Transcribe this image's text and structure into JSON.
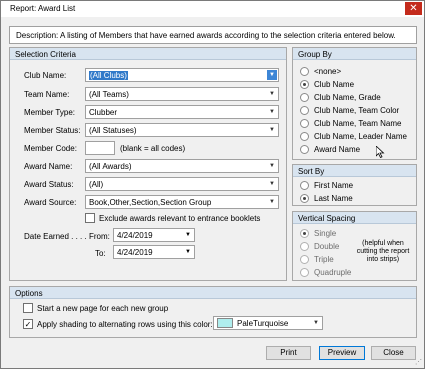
{
  "window": {
    "title": "Report:  Award List",
    "close_symbol": "✕"
  },
  "description": {
    "text": "Description:  A listing of Members that have earned awards according to the selection criteria entered below."
  },
  "selection_criteria": {
    "header": "Selection Criteria",
    "club_name": {
      "label": "Club Name:",
      "value": "(All Clubs)"
    },
    "team_name": {
      "label": "Team Name:",
      "value": "(All Teams)"
    },
    "member_type": {
      "label": "Member Type:",
      "value": "Clubber"
    },
    "member_status": {
      "label": "Member Status:",
      "value": "(All Statuses)"
    },
    "member_code": {
      "label": "Member Code:",
      "value": "",
      "hint": "(blank = all codes)"
    },
    "award_name": {
      "label": "Award Name:",
      "value": "(All Awards)"
    },
    "award_status": {
      "label": "Award Status:",
      "value": "(All)"
    },
    "award_source": {
      "label": "Award Source:",
      "value": "Book,Other,Section,Section Group"
    },
    "exclude_checkbox": {
      "label": "Exclude awards relevant to entrance booklets",
      "checked": false
    },
    "date_earned": {
      "label": "Date Earned . . . .",
      "from_label": "From:",
      "from_value": "4/24/2019",
      "to_label": "To:",
      "to_value": "4/24/2019"
    }
  },
  "group_by": {
    "header": "Group By",
    "options": [
      "<none>",
      "Club Name",
      "Club Name, Grade",
      "Club Name, Team Color",
      "Club Name, Team Name",
      "Club Name, Leader Name",
      "Award Name"
    ],
    "selected": "Club Name"
  },
  "sort_by": {
    "header": "Sort By",
    "options": [
      "First Name",
      "Last Name"
    ],
    "selected": "Last Name"
  },
  "vertical_spacing": {
    "header": "Vertical Spacing",
    "options": [
      "Single",
      "Double",
      "Triple",
      "Quadruple"
    ],
    "selected": "Single",
    "note": "(helpful when cutting the report into strips)"
  },
  "options": {
    "header": "Options",
    "new_page": {
      "label": "Start a new page for each new group",
      "checked": false
    },
    "shading": {
      "label": "Apply shading to alternating rows using this color:",
      "checked": true
    },
    "shading_color": {
      "name": "PaleTurquoise",
      "hex": "#afeeee"
    }
  },
  "buttons": {
    "print": "Print",
    "preview": "Preview",
    "close": "Close"
  },
  "icons": {
    "dropdown": "▼",
    "calendar": "▦",
    "check": "✓"
  }
}
